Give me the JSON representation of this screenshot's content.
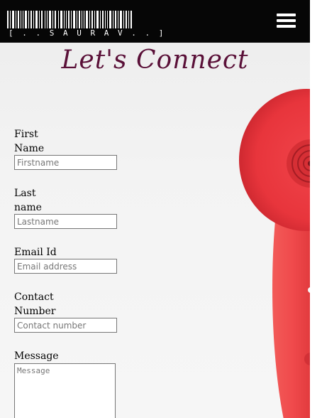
{
  "header": {
    "logo_text": "[ . . S A U R A V . . ]",
    "menu_icon": "hamburger-menu-icon",
    "background": "#060606"
  },
  "page": {
    "title": "Let's Connect",
    "title_color": "#5a1038",
    "background_image": "red telephone handset"
  },
  "form": {
    "first_name": {
      "label_line1": "First",
      "label_line2": "Name",
      "placeholder": "Firstname"
    },
    "last_name": {
      "label_line1": "Last",
      "label_line2": "name",
      "placeholder": "Lastname"
    },
    "email": {
      "label": "Email Id",
      "placeholder": "Email address"
    },
    "contact": {
      "label_line1": "Contact",
      "label_line2": "Number",
      "placeholder": "Contact number"
    },
    "message": {
      "label": "Message",
      "placeholder": "Message"
    }
  }
}
